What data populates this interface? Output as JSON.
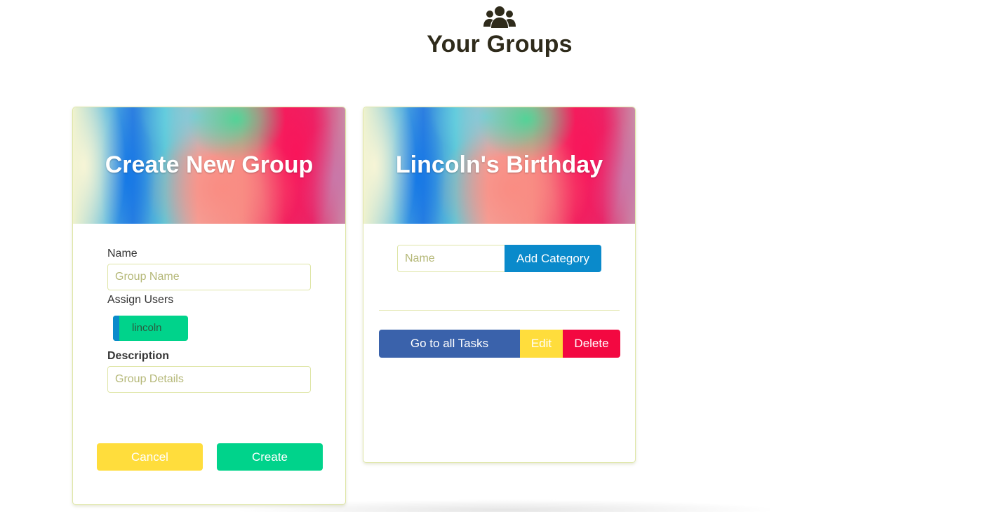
{
  "header": {
    "icon": "users-group-icon",
    "title": "Your Groups"
  },
  "create_card": {
    "title": "Create New Group",
    "name_label": "Name",
    "name_placeholder": "Group Name",
    "assign_label": "Assign Users",
    "users": [
      {
        "label": "lincoln"
      }
    ],
    "description_label": "Description",
    "description_placeholder": "Group Details",
    "cancel_label": "Cancel",
    "create_label": "Create"
  },
  "group_card": {
    "title": "Lincoln's Birthday",
    "category_placeholder": "Name",
    "add_category_label": "Add Category",
    "tasks_label": "Go to all Tasks",
    "edit_label": "Edit",
    "delete_label": "Delete"
  },
  "colors": {
    "title_text": "#2f2b1b",
    "border": "#dfe6a8",
    "cancel": "#ffdd3c",
    "create": "#00d38b",
    "add_category": "#0a8acb",
    "tasks": "#3a62ab",
    "edit": "#ffdd3c",
    "delete": "#f30841",
    "chip": "#00d38b",
    "chip_edge": "#0a8acb"
  }
}
